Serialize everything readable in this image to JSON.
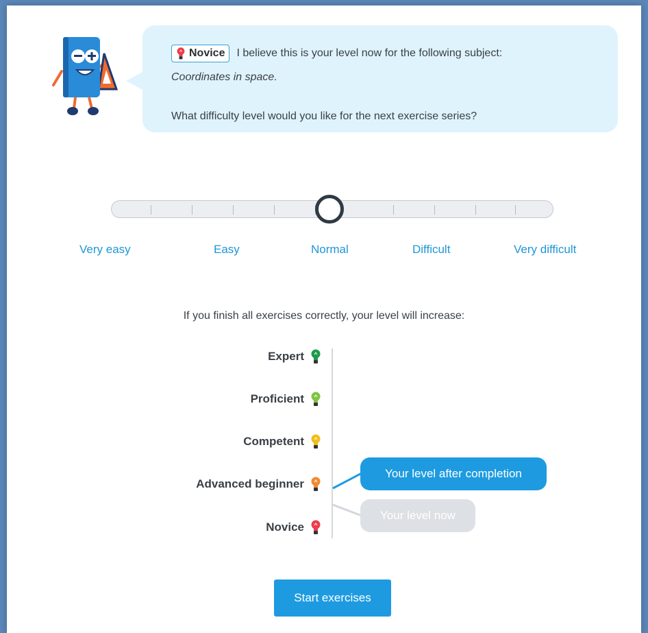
{
  "colors": {
    "accent": "#1e9be0",
    "bubble_bg": "#dff3fc",
    "novice": "#ec3d4c",
    "advanced_beginner": "#f08a32",
    "competent": "#f2bd1b",
    "proficient": "#7dc542",
    "expert": "#1f9a4a"
  },
  "bubble": {
    "level_badge": "Novice",
    "level_icon": "red-lightbulb-icon",
    "message": "I believe this is your level now for the following subject:",
    "subject": "Coordinates in space.",
    "question": "What difficulty level would you like for the next exercise series?"
  },
  "difficulty": {
    "labels": [
      "Very easy",
      "Easy",
      "Normal",
      "Difficult",
      "Very difficult"
    ],
    "selected": "Normal",
    "selected_fraction": 0.5
  },
  "info_text": "If you finish all exercises correctly, your level will increase:",
  "levels": [
    {
      "name": "Expert",
      "icon": "green-lightbulb-icon"
    },
    {
      "name": "Proficient",
      "icon": "lightgreen-lightbulb-icon"
    },
    {
      "name": "Competent",
      "icon": "yellow-lightbulb-icon"
    },
    {
      "name": "Advanced beginner",
      "icon": "orange-lightbulb-icon"
    },
    {
      "name": "Novice",
      "icon": "red-lightbulb-icon"
    }
  ],
  "pill_after": "Your level after completion",
  "pill_now": "Your level now",
  "start_button": "Start exercises"
}
